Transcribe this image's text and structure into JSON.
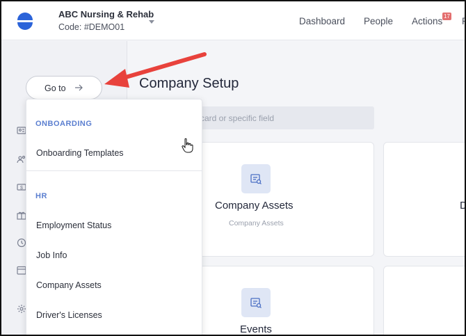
{
  "header": {
    "org_name": "ABC Nursing & Rehab",
    "org_code": "Code: #DEMO01",
    "nav": {
      "dashboard": "Dashboard",
      "people": "People",
      "actions": "Actions",
      "actions_badge": "17",
      "more": "R"
    }
  },
  "sidebar": {
    "goto_label": "Go to",
    "icons": [
      "id-card-icon",
      "people-icon",
      "money-icon",
      "gift-icon",
      "clock-icon",
      "calendar-icon",
      "settings-icon"
    ]
  },
  "main": {
    "title": "Company Setup",
    "search_placeholder": "card or specific field",
    "cards": [
      {
        "title": "Company Assets",
        "subtitle": "Company Assets",
        "icon": "document-icon"
      },
      {
        "title": "D"
      },
      {
        "title": "Events",
        "icon": "document-icon"
      }
    ]
  },
  "dropdown": {
    "sections": [
      {
        "label": "ONBOARDING",
        "items": [
          "Onboarding Templates"
        ]
      },
      {
        "label": "HR",
        "items": [
          "Employment Status",
          "Job Info",
          "Company Assets",
          "Driver's Licenses"
        ]
      }
    ]
  },
  "colors": {
    "accent": "#5b7fd0",
    "brand": "#2b63d9",
    "annotation_arrow": "#e8423c",
    "badge": "#e36f6f"
  }
}
